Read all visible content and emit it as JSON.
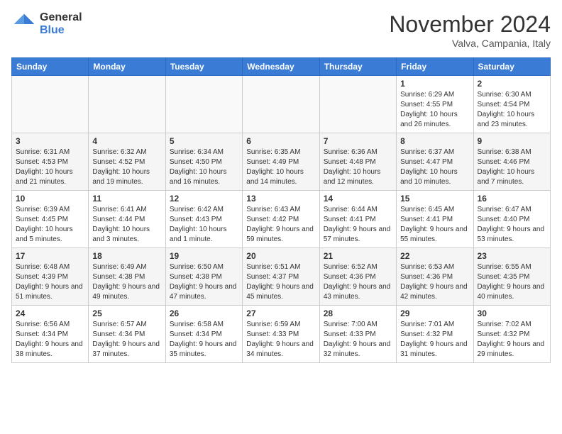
{
  "header": {
    "logo_general": "General",
    "logo_blue": "Blue",
    "month_title": "November 2024",
    "location": "Valva, Campania, Italy"
  },
  "weekdays": [
    "Sunday",
    "Monday",
    "Tuesday",
    "Wednesday",
    "Thursday",
    "Friday",
    "Saturday"
  ],
  "weeks": [
    [
      {
        "day": "",
        "info": ""
      },
      {
        "day": "",
        "info": ""
      },
      {
        "day": "",
        "info": ""
      },
      {
        "day": "",
        "info": ""
      },
      {
        "day": "",
        "info": ""
      },
      {
        "day": "1",
        "info": "Sunrise: 6:29 AM\nSunset: 4:55 PM\nDaylight: 10 hours and 26 minutes."
      },
      {
        "day": "2",
        "info": "Sunrise: 6:30 AM\nSunset: 4:54 PM\nDaylight: 10 hours and 23 minutes."
      }
    ],
    [
      {
        "day": "3",
        "info": "Sunrise: 6:31 AM\nSunset: 4:53 PM\nDaylight: 10 hours and 21 minutes."
      },
      {
        "day": "4",
        "info": "Sunrise: 6:32 AM\nSunset: 4:52 PM\nDaylight: 10 hours and 19 minutes."
      },
      {
        "day": "5",
        "info": "Sunrise: 6:34 AM\nSunset: 4:50 PM\nDaylight: 10 hours and 16 minutes."
      },
      {
        "day": "6",
        "info": "Sunrise: 6:35 AM\nSunset: 4:49 PM\nDaylight: 10 hours and 14 minutes."
      },
      {
        "day": "7",
        "info": "Sunrise: 6:36 AM\nSunset: 4:48 PM\nDaylight: 10 hours and 12 minutes."
      },
      {
        "day": "8",
        "info": "Sunrise: 6:37 AM\nSunset: 4:47 PM\nDaylight: 10 hours and 10 minutes."
      },
      {
        "day": "9",
        "info": "Sunrise: 6:38 AM\nSunset: 4:46 PM\nDaylight: 10 hours and 7 minutes."
      }
    ],
    [
      {
        "day": "10",
        "info": "Sunrise: 6:39 AM\nSunset: 4:45 PM\nDaylight: 10 hours and 5 minutes."
      },
      {
        "day": "11",
        "info": "Sunrise: 6:41 AM\nSunset: 4:44 PM\nDaylight: 10 hours and 3 minutes."
      },
      {
        "day": "12",
        "info": "Sunrise: 6:42 AM\nSunset: 4:43 PM\nDaylight: 10 hours and 1 minute."
      },
      {
        "day": "13",
        "info": "Sunrise: 6:43 AM\nSunset: 4:42 PM\nDaylight: 9 hours and 59 minutes."
      },
      {
        "day": "14",
        "info": "Sunrise: 6:44 AM\nSunset: 4:41 PM\nDaylight: 9 hours and 57 minutes."
      },
      {
        "day": "15",
        "info": "Sunrise: 6:45 AM\nSunset: 4:41 PM\nDaylight: 9 hours and 55 minutes."
      },
      {
        "day": "16",
        "info": "Sunrise: 6:47 AM\nSunset: 4:40 PM\nDaylight: 9 hours and 53 minutes."
      }
    ],
    [
      {
        "day": "17",
        "info": "Sunrise: 6:48 AM\nSunset: 4:39 PM\nDaylight: 9 hours and 51 minutes."
      },
      {
        "day": "18",
        "info": "Sunrise: 6:49 AM\nSunset: 4:38 PM\nDaylight: 9 hours and 49 minutes."
      },
      {
        "day": "19",
        "info": "Sunrise: 6:50 AM\nSunset: 4:38 PM\nDaylight: 9 hours and 47 minutes."
      },
      {
        "day": "20",
        "info": "Sunrise: 6:51 AM\nSunset: 4:37 PM\nDaylight: 9 hours and 45 minutes."
      },
      {
        "day": "21",
        "info": "Sunrise: 6:52 AM\nSunset: 4:36 PM\nDaylight: 9 hours and 43 minutes."
      },
      {
        "day": "22",
        "info": "Sunrise: 6:53 AM\nSunset: 4:36 PM\nDaylight: 9 hours and 42 minutes."
      },
      {
        "day": "23",
        "info": "Sunrise: 6:55 AM\nSunset: 4:35 PM\nDaylight: 9 hours and 40 minutes."
      }
    ],
    [
      {
        "day": "24",
        "info": "Sunrise: 6:56 AM\nSunset: 4:34 PM\nDaylight: 9 hours and 38 minutes."
      },
      {
        "day": "25",
        "info": "Sunrise: 6:57 AM\nSunset: 4:34 PM\nDaylight: 9 hours and 37 minutes."
      },
      {
        "day": "26",
        "info": "Sunrise: 6:58 AM\nSunset: 4:34 PM\nDaylight: 9 hours and 35 minutes."
      },
      {
        "day": "27",
        "info": "Sunrise: 6:59 AM\nSunset: 4:33 PM\nDaylight: 9 hours and 34 minutes."
      },
      {
        "day": "28",
        "info": "Sunrise: 7:00 AM\nSunset: 4:33 PM\nDaylight: 9 hours and 32 minutes."
      },
      {
        "day": "29",
        "info": "Sunrise: 7:01 AM\nSunset: 4:32 PM\nDaylight: 9 hours and 31 minutes."
      },
      {
        "day": "30",
        "info": "Sunrise: 7:02 AM\nSunset: 4:32 PM\nDaylight: 9 hours and 29 minutes."
      }
    ]
  ]
}
